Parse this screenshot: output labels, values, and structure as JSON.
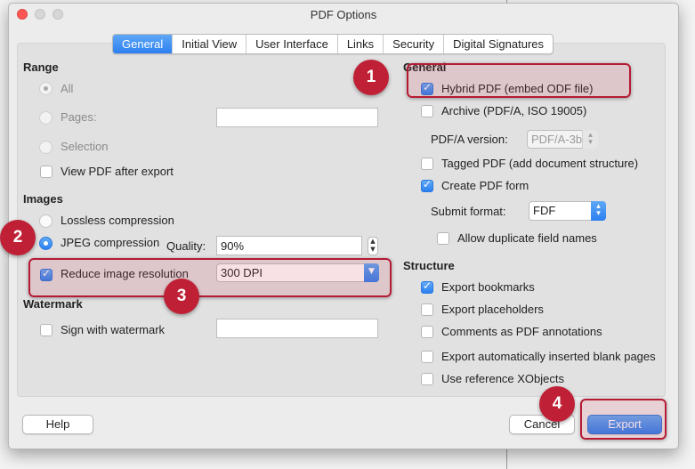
{
  "window": {
    "title": "PDF Options"
  },
  "tabs": [
    {
      "label": "General",
      "active": true
    },
    {
      "label": "Initial View"
    },
    {
      "label": "User Interface"
    },
    {
      "label": "Links"
    },
    {
      "label": "Security"
    },
    {
      "label": "Digital Signatures"
    }
  ],
  "left": {
    "range": {
      "heading": "Range",
      "all_label": "All",
      "pages_label": "Pages:",
      "pages_value": "",
      "selection_label": "Selection",
      "view_after_export_label": "View PDF after export"
    },
    "images": {
      "heading": "Images",
      "lossless_label": "Lossless compression",
      "jpeg_label": "JPEG compression",
      "quality_label": "Quality:",
      "quality_value": "90%",
      "reduce_label": "Reduce image resolution",
      "reduce_value": "300 DPI"
    },
    "watermark": {
      "heading": "Watermark",
      "sign_label": "Sign with watermark",
      "text_value": ""
    }
  },
  "right": {
    "general": {
      "heading": "General",
      "hybrid_label": "Hybrid PDF (embed ODF file)",
      "archive_label": "Archive (PDF/A, ISO 19005)",
      "pdfa_version_label": "PDF/A version:",
      "pdfa_version_value": "PDF/A-3b",
      "tagged_label": "Tagged PDF (add document structure)",
      "create_form_label": "Create PDF form",
      "submit_format_label": "Submit format:",
      "submit_format_value": "FDF",
      "allow_duplicate_label": "Allow duplicate field names"
    },
    "structure": {
      "heading": "Structure",
      "bookmarks_label": "Export bookmarks",
      "placeholders_label": "Export placeholders",
      "comments_label": "Comments as PDF annotations",
      "blank_pages_label": "Export automatically inserted blank pages",
      "xobjects_label": "Use reference XObjects"
    }
  },
  "buttons": {
    "help": "Help",
    "cancel": "Cancel",
    "export": "Export"
  },
  "annotations": {
    "badge1": "1",
    "badge2": "2",
    "badge3": "3",
    "badge4": "4"
  },
  "colors": {
    "accent": "#2c7ff0",
    "highlight": "#b51b34",
    "badge": "#bf2035"
  }
}
